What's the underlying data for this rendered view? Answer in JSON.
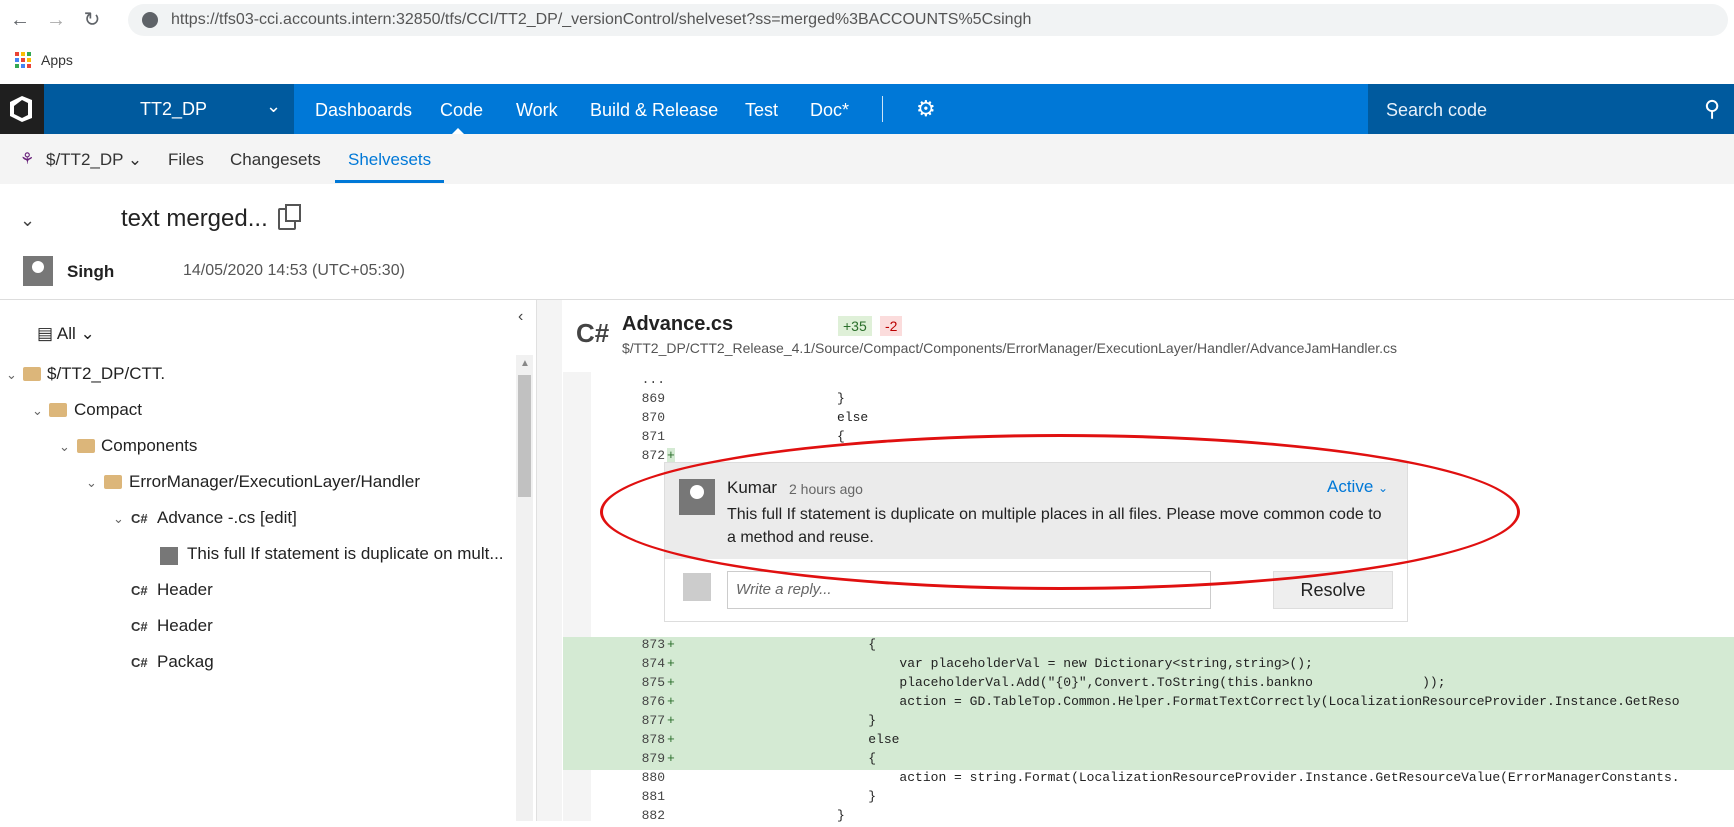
{
  "browser": {
    "url": "https://tfs03-cci.accounts.intern:32850/tfs/CCI/TT2_DP/_versionControl/shelveset?ss=merged%3BACCOUNTS%5Csingh",
    "back_icon": "←",
    "forward_icon": "→",
    "reload_icon": "↻",
    "bookmarks_apps_label": "Apps"
  },
  "topbar": {
    "project": "TT2_DP",
    "nav": [
      "Dashboards",
      "Code",
      "Work",
      "Build & Release",
      "Test",
      "Doc*"
    ],
    "active_nav": "Code",
    "search_placeholder": "Search code",
    "accent_color": "#0078d7"
  },
  "subnav": {
    "repo": "$/TT2_DP",
    "tabs": [
      "Files",
      "Changesets",
      "Shelvesets"
    ],
    "active_tab": "Shelvesets"
  },
  "header": {
    "title": "text merged...",
    "author": "Singh",
    "date": "14/05/2020 14:53 (UTC+05:30)"
  },
  "tree": {
    "filter": "All",
    "items": [
      {
        "label": "$/TT2_DP/CTT.",
        "type": "folder"
      },
      {
        "label": "Compact",
        "type": "folder"
      },
      {
        "label": "Components",
        "type": "folder"
      },
      {
        "label": "ErrorManager/ExecutionLayer/Handler",
        "type": "folder"
      },
      {
        "label": "Advance -.cs [edit]",
        "type": "cs"
      },
      {
        "label": "This full If statement is duplicate on mult...",
        "type": "comment"
      },
      {
        "label": "Header",
        "type": "cs"
      },
      {
        "label": "Header",
        "type": "cs"
      },
      {
        "label": "Packag",
        "type": "cs"
      }
    ]
  },
  "file": {
    "lang_icon": "C#",
    "name": "Advance.cs",
    "added": "+35",
    "removed": "-2",
    "path": "$/TT2_DP/CTT2_Release_4.1/Source/Compact/Components/ErrorManager/ExecutionLayer/Handler/AdvanceJamHandler.cs"
  },
  "code_before": [
    {
      "ln": "...",
      "marker": "",
      "code": "",
      "added": false
    },
    {
      "ln": "869",
      "marker": "",
      "code": "                    }",
      "added": false
    },
    {
      "ln": "870",
      "marker": "",
      "code": "                    else",
      "added": false
    },
    {
      "ln": "871",
      "marker": "",
      "code": "                    {",
      "added": false
    },
    {
      "ln": "872",
      "marker": "+",
      "code": "",
      "added": false
    }
  ],
  "code_after": [
    {
      "ln": "873",
      "marker": "+",
      "code": "                        {",
      "added": true
    },
    {
      "ln": "874",
      "marker": "+",
      "code": "                            var placeholderVal = new Dictionary<string,string>();",
      "added": true
    },
    {
      "ln": "875",
      "marker": "+",
      "code": "                            placeholderVal.Add(\"{0}\",Convert.ToString(this.bankno              ));",
      "added": true
    },
    {
      "ln": "876",
      "marker": "+",
      "code": "                            action = GD.TableTop.Common.Helper.FormatTextCorrectly(LocalizationResourceProvider.Instance.GetReso",
      "added": true
    },
    {
      "ln": "877",
      "marker": "+",
      "code": "                        }",
      "added": true
    },
    {
      "ln": "878",
      "marker": "+",
      "code": "                        else",
      "added": true
    },
    {
      "ln": "879",
      "marker": "+",
      "code": "                        {",
      "added": true
    },
    {
      "ln": "880",
      "marker": "",
      "code": "                            action = string.Format(LocalizationResourceProvider.Instance.GetResourceValue(ErrorManagerConstants.",
      "added": false
    },
    {
      "ln": "881",
      "marker": "",
      "code": "                        }",
      "added": false
    },
    {
      "ln": "882",
      "marker": "",
      "code": "                    }",
      "added": false
    }
  ],
  "comment": {
    "author": "Kumar",
    "time": "2 hours ago",
    "status": "Active",
    "text": "This full If statement is duplicate on multiple places in all files. Please move common code to a method and reuse.",
    "reply_placeholder": "Write a reply...",
    "resolve_label": "Resolve"
  },
  "annotation_color": "#e01010"
}
